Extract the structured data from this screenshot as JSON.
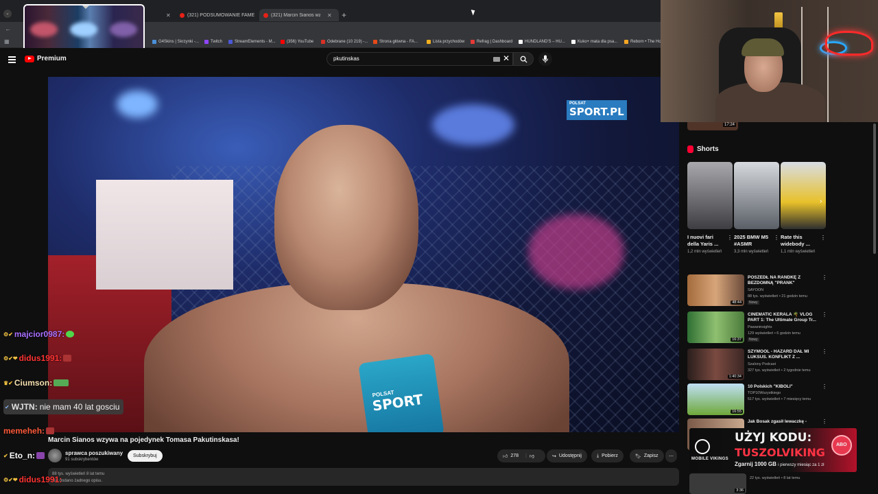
{
  "browser": {
    "tabs": [
      {
        "label": ""
      },
      {
        "label": "(321) PODSUMOWANIE FAME"
      },
      {
        "label": "(321) Marcin Sianos wzywa"
      }
    ],
    "bookmarks": [
      {
        "label": "G4Skins | Skrzynki -...",
        "color": "#4a90d9"
      },
      {
        "label": "Twitch",
        "color": "#9146ff"
      },
      {
        "label": "StreamElements - M...",
        "color": "#4b58d8"
      },
      {
        "label": "(356) YouTube",
        "color": "#ff0000"
      },
      {
        "label": "Odebrane (10 219) -...",
        "color": "#d93025"
      },
      {
        "label": "Strona główna - FA...",
        "color": "#e64a19"
      },
      {
        "label": "Lista przychodów",
        "color": "#f2b01e"
      },
      {
        "label": "Refrag | Dashboard",
        "color": "#e53935"
      },
      {
        "label": "HUNDLAND'S – HU...",
        "color": "#ffffff"
      },
      {
        "label": "Kuko+ mata dla psa...",
        "color": "#ffffff"
      },
      {
        "label": "Reborn • The Ho",
        "color": "#f5a623"
      }
    ]
  },
  "youtube": {
    "logo": "Premium",
    "search_value": "pkutinskas",
    "video_title": "Marcin Sianos wzywa na pojedynek Tomasa Pakutinskasa!",
    "channel_name": "sprawca poszukiwany",
    "channel_subs": "91 subskrybentów",
    "subscribe_label": "Subskrybuj",
    "likes": "278",
    "share_label": "Udostępnij",
    "download_label": "Pobierz",
    "save_label": "Zapisz",
    "views_line": "88 tys. wyświetleń  8 lat temu",
    "desc_line": "Nie dodano żadnego opisu.",
    "video_overlay": {
      "polsat_small": "POLSAT",
      "polsat_big": "SPORT.PL",
      "mic_small": "POLSAT",
      "mic_big": "SPORT"
    }
  },
  "sidebar": {
    "top_duration": "17:24",
    "shorts_label": "Shorts",
    "shorts": [
      {
        "title": "I nuovi fari della Yaris ...",
        "views": "1,2 mln wyświetleń",
        "color": "#6f6f73"
      },
      {
        "title": "2025 BMW M5 #ASMR",
        "views": "3,3 mln wyświetleń",
        "color": "#8a8e96"
      },
      {
        "title": "Rate this widebody ...",
        "views": "1,1 mln wyświetleń",
        "color": "#c8a62a"
      }
    ],
    "videos": [
      {
        "title": "POSZEDŁ NA RANDKĘ Z BEZDOMNĄ \"PRANK\"",
        "channel": "SAYOON",
        "views": "88 tys. wyświetleń • 21 godzin temu",
        "badge": "Nowy",
        "duration": "48:44",
        "color": "#a46b3c"
      },
      {
        "title": "CINEMATIC KERALA 🌴 VLOG PART 1: The Ultimate Group Tr...",
        "channel": "Pawaninsights",
        "views": "129 wyświetleń • 6 godzin temu",
        "badge": "Nowy",
        "duration": "16:37",
        "color": "#3f8a3a"
      },
      {
        "title": "SZYMOOL - HAZARD DAŁ MI LUKSUS. KONFLIKT Z ...",
        "channel": "Szalony Podcast",
        "views": "327 tys. wyświetleń • 2 tygodnie temu",
        "badge": "",
        "duration": "1:40:34",
        "color": "#5b3a36"
      },
      {
        "title": "10 Polskich \"KIBOLI\"",
        "channel": "TOP10Wszystkiego",
        "views": "517 tys. wyświetleń • 7 miesięcy temu",
        "badge": "",
        "duration": "16:55",
        "color": "#6fa83a"
      },
      {
        "title": "Jak Bosak zgasił lewaczkę -",
        "channel": "",
        "views": "",
        "badge": "",
        "duration": "",
        "color": "#7a5a48"
      }
    ],
    "last_views": "22 tys. wyświetleń • 8 lat temu",
    "last_duration": "3:36"
  },
  "chat": [
    {
      "name": "majcior0987:",
      "color": "#a970ff",
      "emote": "#4fd84a"
    },
    {
      "name": "didus1991:",
      "color": "#ff3333",
      "emote": "#aa3333"
    },
    {
      "name": "Ciumson:",
      "color": "#f6e0b0",
      "emote": "#55aa55"
    },
    {
      "name": "WJTN:",
      "color": "#e0e0e0",
      "emote": ""
    },
    {
      "name": "memeheh:",
      "color": "#ff5a3a",
      "emote": "#aa3333"
    },
    {
      "name": "Eto_n:",
      "color": "#ffffff",
      "emote": "#8844aa"
    },
    {
      "name": "didus1991:",
      "color": "#ff3333",
      "emote": ""
    }
  ],
  "chat_message": "nie mam 40 lat gosciu",
  "ad": {
    "brand": "MOBILE VIKINGS",
    "line1": "UŻYJ KODU:",
    "line2": "TUSZOLVIKING",
    "line3": "Zgarnij 1000 GB",
    "line3_small": "i pierwszy miesiąc za 1 zł",
    "badge": "ABO"
  }
}
